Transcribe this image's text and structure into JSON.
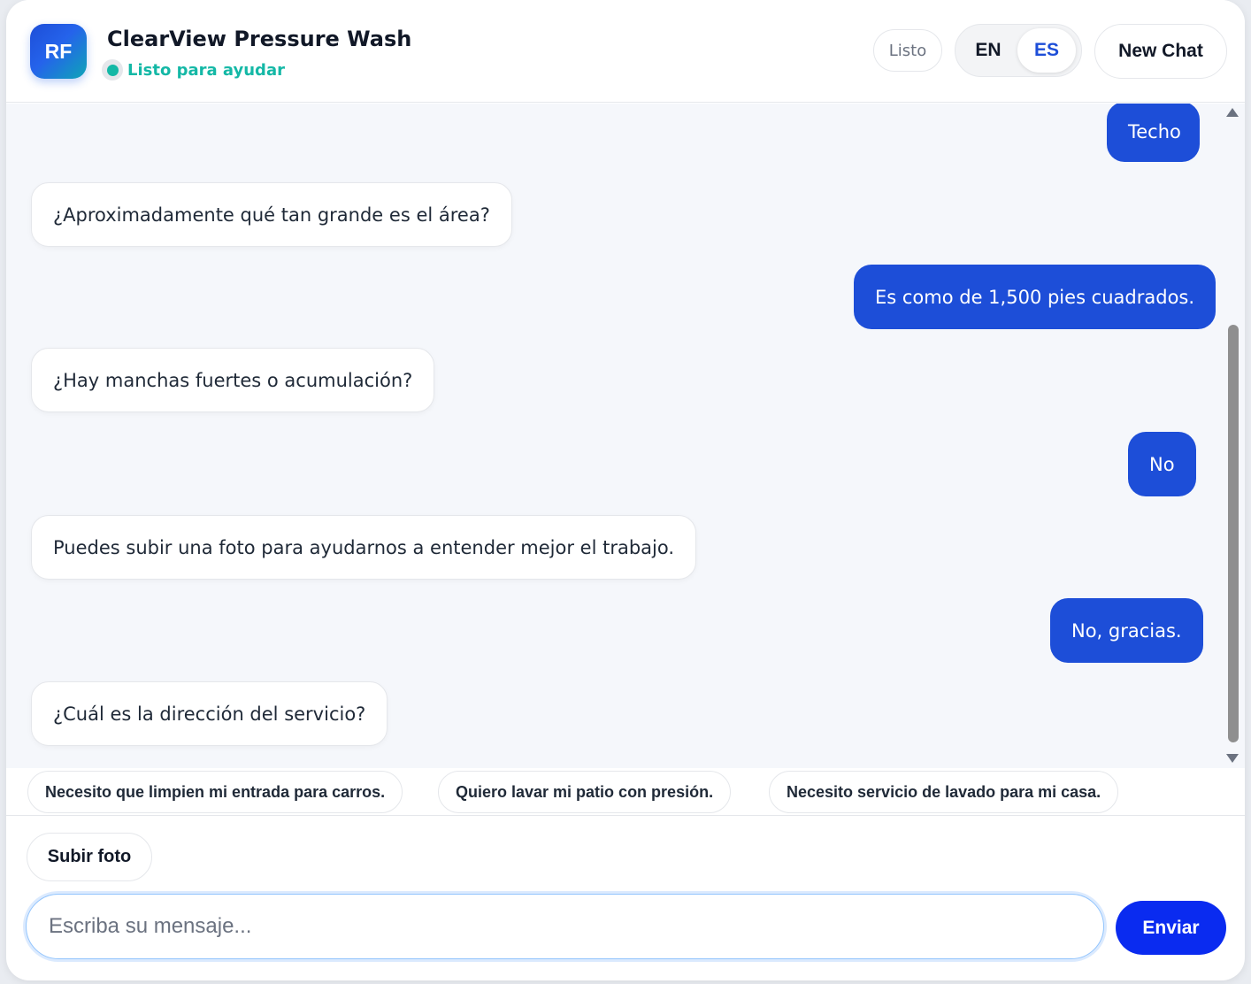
{
  "header": {
    "avatar_initials": "RF",
    "title": "ClearView Pressure Wash",
    "status": "Listo para ayudar",
    "status_badge": "Listo",
    "lang_en": "EN",
    "lang_es": "ES",
    "active_language": "ES",
    "new_chat_label": "New Chat"
  },
  "messages": [
    {
      "role": "user",
      "text": "Techo"
    },
    {
      "role": "bot",
      "text": "¿Aproximadamente qué tan grande es el área?"
    },
    {
      "role": "user",
      "text": "Es como de 1,500 pies cuadrados."
    },
    {
      "role": "bot",
      "text": "¿Hay manchas fuertes o acumulación?"
    },
    {
      "role": "user",
      "text": "No"
    },
    {
      "role": "bot",
      "text": "Puedes subir una foto para ayudarnos a entender mejor el trabajo."
    },
    {
      "role": "user",
      "text": "No, gracias."
    },
    {
      "role": "bot",
      "text": "¿Cuál es la dirección del servicio?"
    }
  ],
  "suggestions": [
    "Necesito que limpien mi entrada para carros.",
    "Quiero lavar mi patio con presión.",
    "Necesito servicio de lavado para mi casa."
  ],
  "composer": {
    "upload_label": "Subir foto",
    "placeholder": "Escriba su mensaje...",
    "value": "",
    "send_label": "Enviar"
  },
  "colors": {
    "accent": "#1d4ed8",
    "send": "#0a2bf0",
    "status": "#14b8a6"
  }
}
